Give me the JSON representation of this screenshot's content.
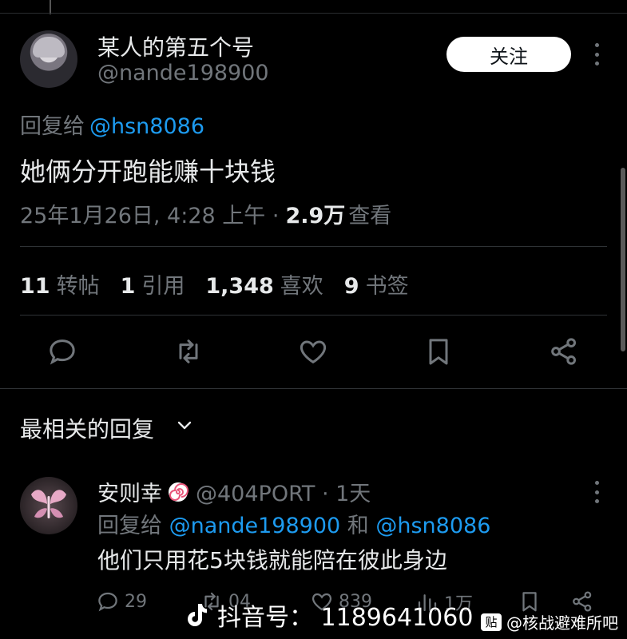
{
  "tweet": {
    "display_name": "某人的第五个号",
    "handle": "@nande198900",
    "follow_label": "关注",
    "reply_to_prefix": "回复给",
    "reply_to_mention": "@hsn8086",
    "text": "她俩分开跑能赚十块钱",
    "timestamp": "25年1月26日, 4:28 上午 ·",
    "views": "2.9万",
    "views_label": "查看"
  },
  "stats": [
    {
      "num": "11",
      "label": "转帖"
    },
    {
      "num": "1",
      "label": "引用"
    },
    {
      "num": "1,348",
      "label": "喜欢"
    },
    {
      "num": "9",
      "label": "书签"
    }
  ],
  "actions": {
    "icons": [
      "comment-icon",
      "retweet-icon",
      "heart-icon",
      "bookmark-icon",
      "share-icon"
    ],
    "icon_color": "#71767b"
  },
  "replies_section": {
    "sort_label": "最相关的回复"
  },
  "reply": {
    "display_name": "安则幸",
    "badge_icon": "spiral-candy-icon",
    "handle_time": "@404PORT · 1天",
    "reply_to_prefix": "回复给",
    "mention_1": "@nande198900",
    "conjunction": "和",
    "mention_2": "@hsn8086",
    "text": "他们只用花5块钱就能陪在彼此身边",
    "counts": {
      "comments": "29",
      "retweets": "04",
      "likes": "839",
      "views": "1万"
    }
  },
  "watermarks": {
    "douyin": "抖音号：  1189641060",
    "tieba": "@核战避难所吧",
    "tieba_logo": "贴"
  },
  "colors": {
    "background": "#000000",
    "text": "#e7e9ea",
    "muted": "#71767b",
    "link": "#1d9bf0"
  }
}
